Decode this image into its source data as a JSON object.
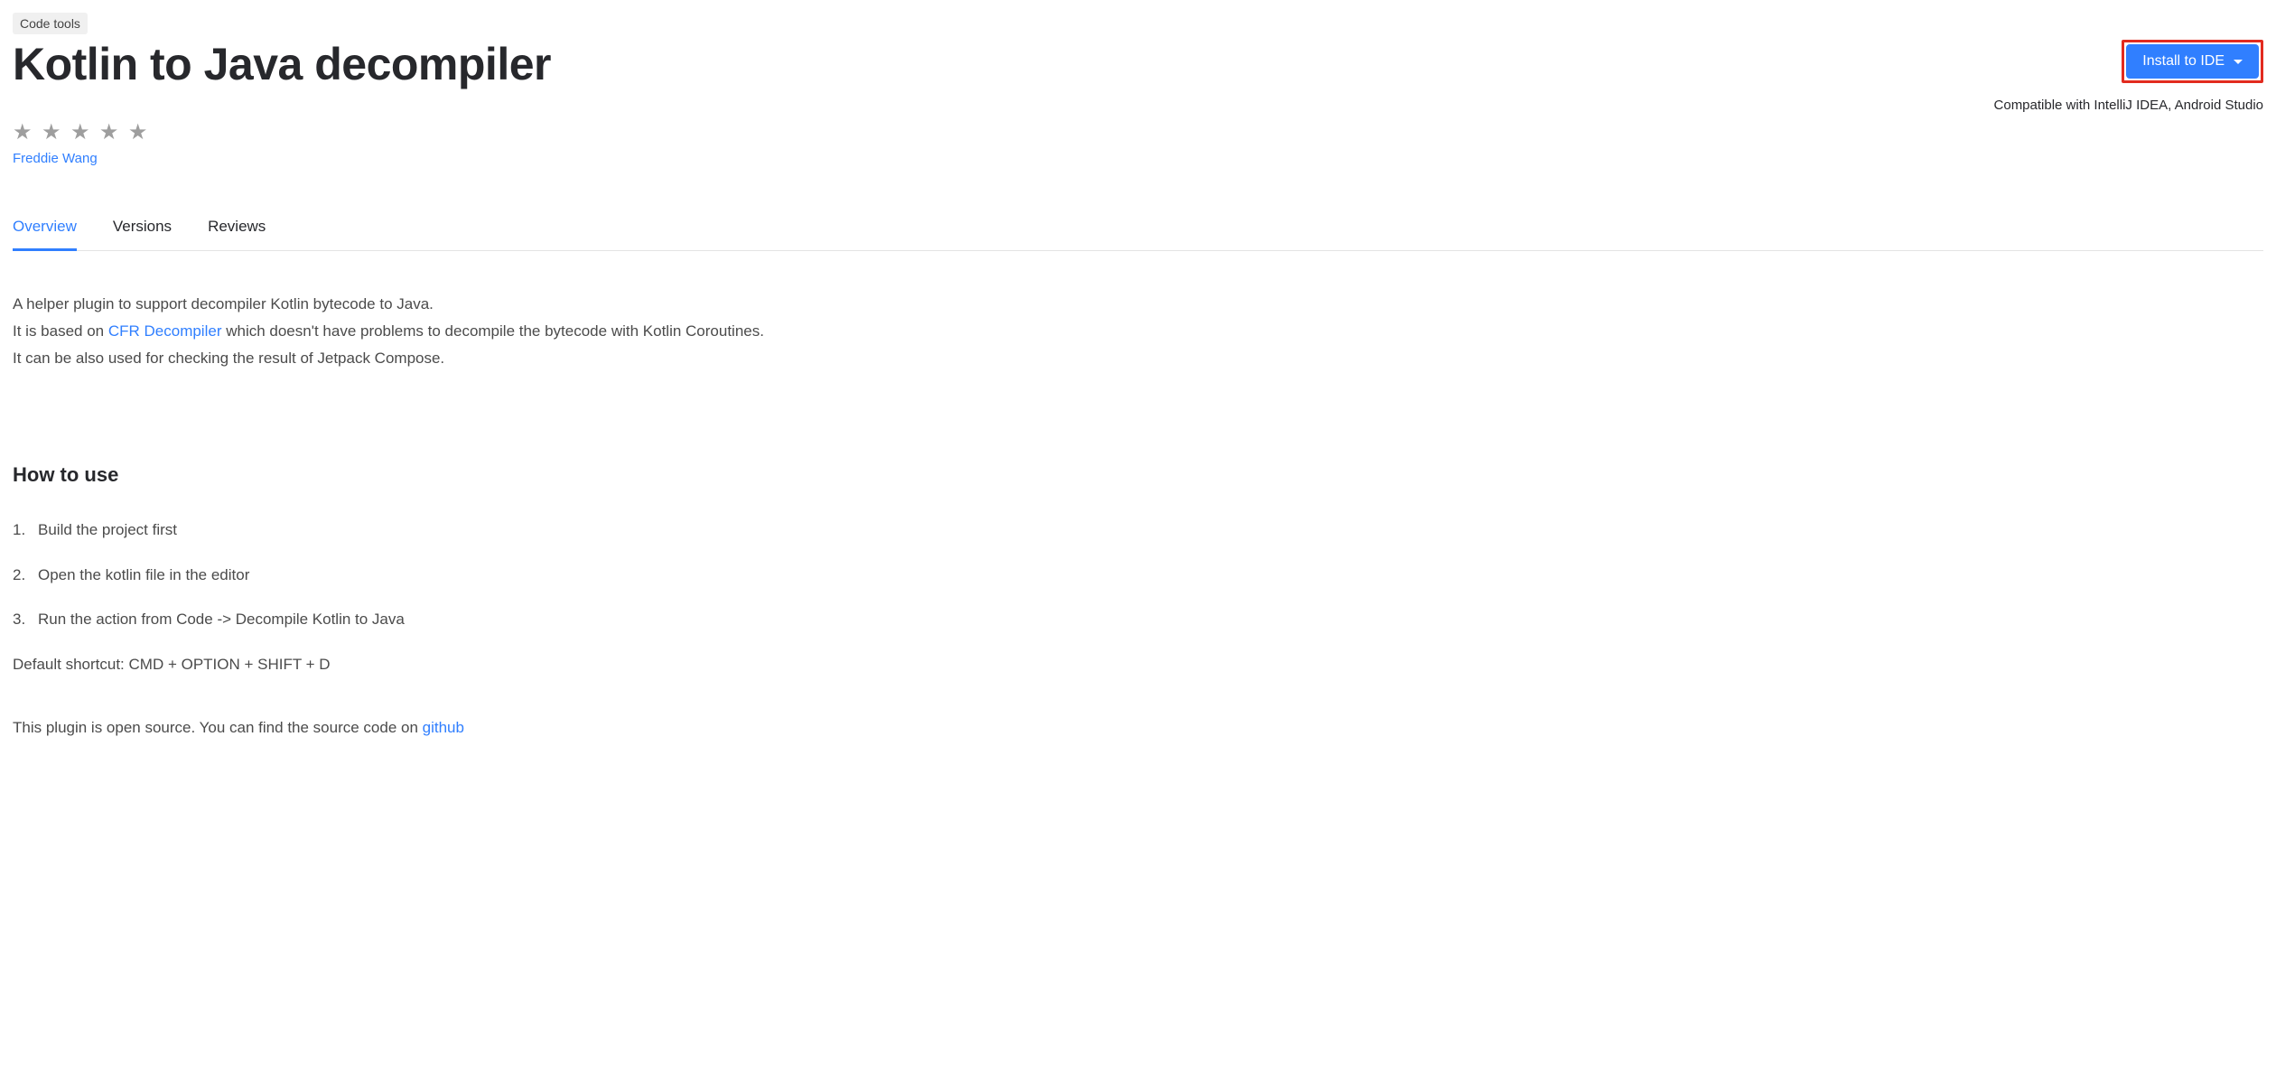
{
  "category_tag": "Code tools",
  "title": "Kotlin to Java decompiler",
  "install_button": "Install to IDE",
  "compatibility": "Compatible with IntelliJ IDEA, Android Studio",
  "author": "Freddie Wang",
  "tabs": {
    "overview": "Overview",
    "versions": "Versions",
    "reviews": "Reviews"
  },
  "description": {
    "line1": "A helper plugin to support decompiler Kotlin bytecode to Java.",
    "line2_prefix": "It is based on ",
    "line2_link": "CFR Decompiler",
    "line2_suffix": " which doesn't have problems to decompile the bytecode with Kotlin Coroutines.",
    "line3": "It can be also used for checking the result of Jetpack Compose."
  },
  "howto_heading": "How to use",
  "steps": [
    "Build the project first",
    "Open the kotlin file in the editor",
    "Run the action from Code -> Decompile Kotlin to Java"
  ],
  "shortcut_note": "Default shortcut: CMD + OPTION + SHIFT + D",
  "source_prefix": "This plugin is open source. You can find the source code on ",
  "source_link": "github"
}
